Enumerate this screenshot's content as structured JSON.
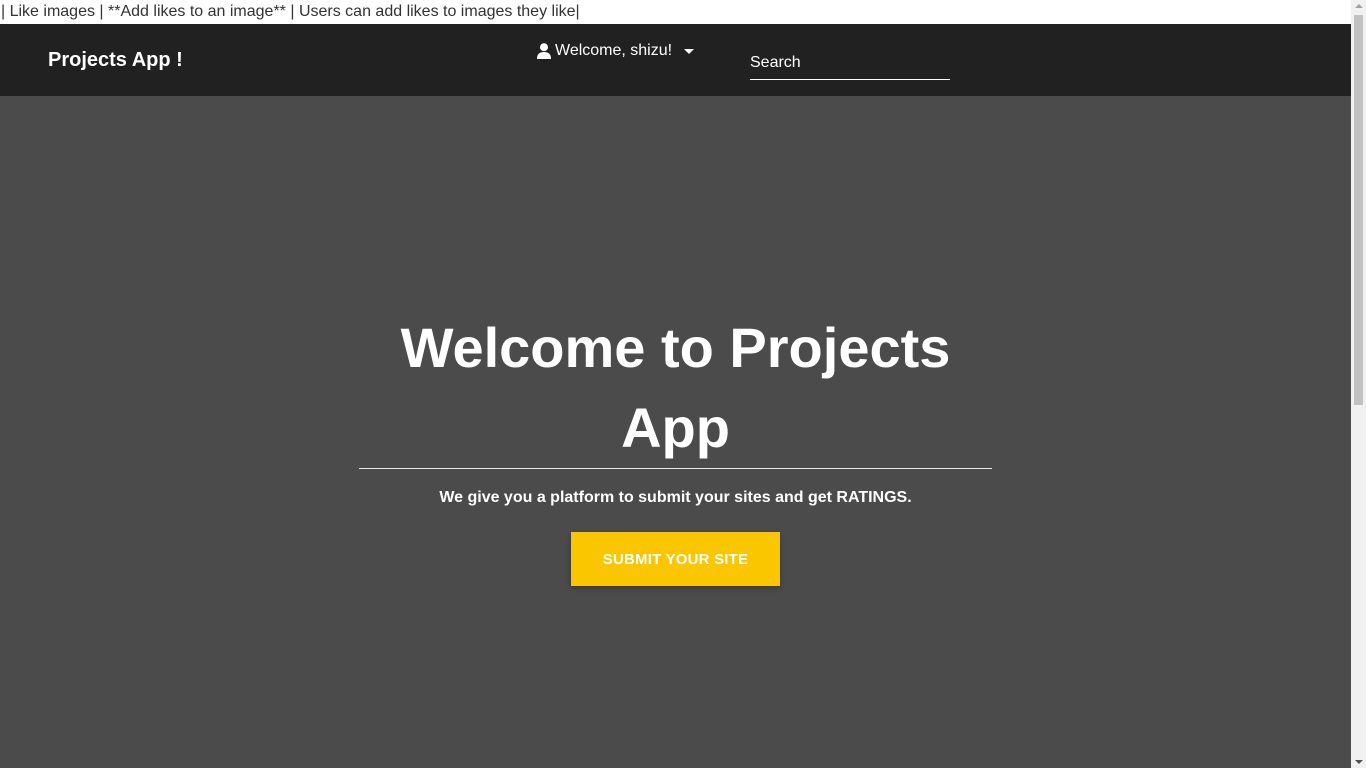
{
  "topline": {
    "text": "| Like images | **Add likes to an image** | Users can add likes to images they like|"
  },
  "navbar": {
    "brand": "Projects App !",
    "user_menu": {
      "label": "Welcome, shizu!",
      "icon": "user-icon"
    },
    "search": {
      "placeholder": "Search",
      "value": ""
    }
  },
  "hero": {
    "title": "Welcome to Projects App",
    "subtitle": "We give you a platform to submit your sites and get RATINGS.",
    "cta_label": "SUBMIT YOUR SITE"
  },
  "colors": {
    "navbar_bg": "#212121",
    "hero_bg": "#4b4b4b",
    "accent": "#f9c600",
    "text_light": "#ffffff"
  }
}
